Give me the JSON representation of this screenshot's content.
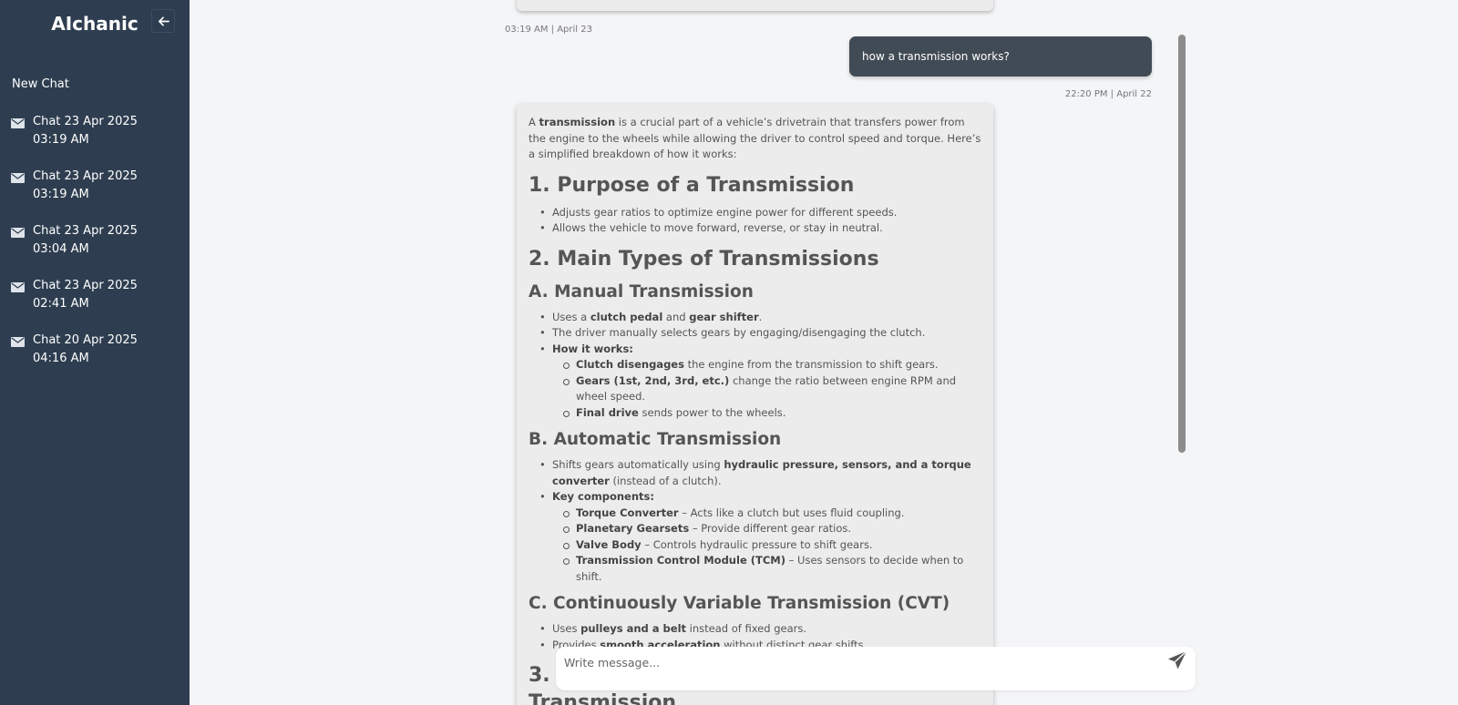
{
  "sidebar": {
    "brand": "AIchanic",
    "new_chat": "New Chat",
    "chats": [
      {
        "label": "Chat 23 Apr 2025 03:19 AM"
      },
      {
        "label": "Chat 23 Apr 2025 03:19 AM"
      },
      {
        "label": "Chat 23 Apr 2025 03:04 AM"
      },
      {
        "label": "Chat 23 Apr 2025 02:41 AM"
      },
      {
        "label": "Chat 20 Apr 2025 04:16 AM"
      }
    ],
    "icons": {
      "collapse": "arrow-left-icon",
      "chat": "mail-icon"
    },
    "bg_color": "#2e3e50"
  },
  "chat": {
    "prev_timestamp": "03:19 AM | April 23",
    "user_message": "how a transmission works?",
    "user_timestamp": "22:20 PM | April 22",
    "answer": {
      "intro": {
        "t1": "A ",
        "b1": "transmission",
        "t2": " is a crucial part of a vehicle’s drivetrain that transfers power from the engine to the wheels while allowing the driver to control speed and torque. Here’s a simplified breakdown of how it works:"
      },
      "h_purpose": "1. Purpose of a Transmission",
      "purpose_items": [
        "Adjusts gear ratios to optimize engine power for different speeds.",
        "Allows the vehicle to move forward, reverse, or stay in neutral."
      ],
      "h_types": "2. Main Types of Transmissions",
      "manual": {
        "heading": "A. Manual Transmission",
        "item1": {
          "t1": "Uses a ",
          "b1": "clutch pedal",
          "t2": " and ",
          "b2": "gear shifter",
          "t3": "."
        },
        "item2": "The driver manually selects gears by engaging/disengaging the clutch.",
        "how_label": "How it works:",
        "sub": [
          {
            "b": "Clutch disengages",
            "t": " the engine from the transmission to shift gears."
          },
          {
            "b": "Gears (1st, 2nd, 3rd, etc.)",
            "t": " change the ratio between engine RPM and wheel speed."
          },
          {
            "b": "Final drive",
            "t": " sends power to the wheels."
          }
        ]
      },
      "automatic": {
        "heading": "B. Automatic Transmission",
        "item1": {
          "t1": "Shifts gears automatically using ",
          "b1": "hydraulic pressure, sensors, and a torque converter",
          "t2": " (instead of a clutch)."
        },
        "key_label": "Key components:",
        "sub": [
          {
            "b": "Torque Converter",
            "t": " – Acts like a clutch but uses fluid coupling."
          },
          {
            "b": "Planetary Gearsets",
            "t": " – Provide different gear ratios."
          },
          {
            "b": "Valve Body",
            "t": " – Controls hydraulic pressure to shift gears."
          },
          {
            "b": "Transmission Control Module (TCM)",
            "t": " – Uses sensors to decide when to shift."
          }
        ]
      },
      "cvt": {
        "heading": "C. Continuously Variable Transmission (CVT)",
        "item1": {
          "t1": "Uses ",
          "b1": "pulleys and a belt",
          "t2": " instead of fixed gears."
        },
        "item2": {
          "t1": "Provides ",
          "b1": "smooth acceleration",
          "t2": " without distinct gear shifts."
        }
      },
      "h_partial": "3.",
      "h_partial_2": "Transmission"
    }
  },
  "composer": {
    "placeholder": "Write message...",
    "send_icon": "send-icon"
  },
  "colors": {
    "user_bubble": "#414b55",
    "answer_bg": "#ececec",
    "page_bg": "#f4f5f7"
  }
}
